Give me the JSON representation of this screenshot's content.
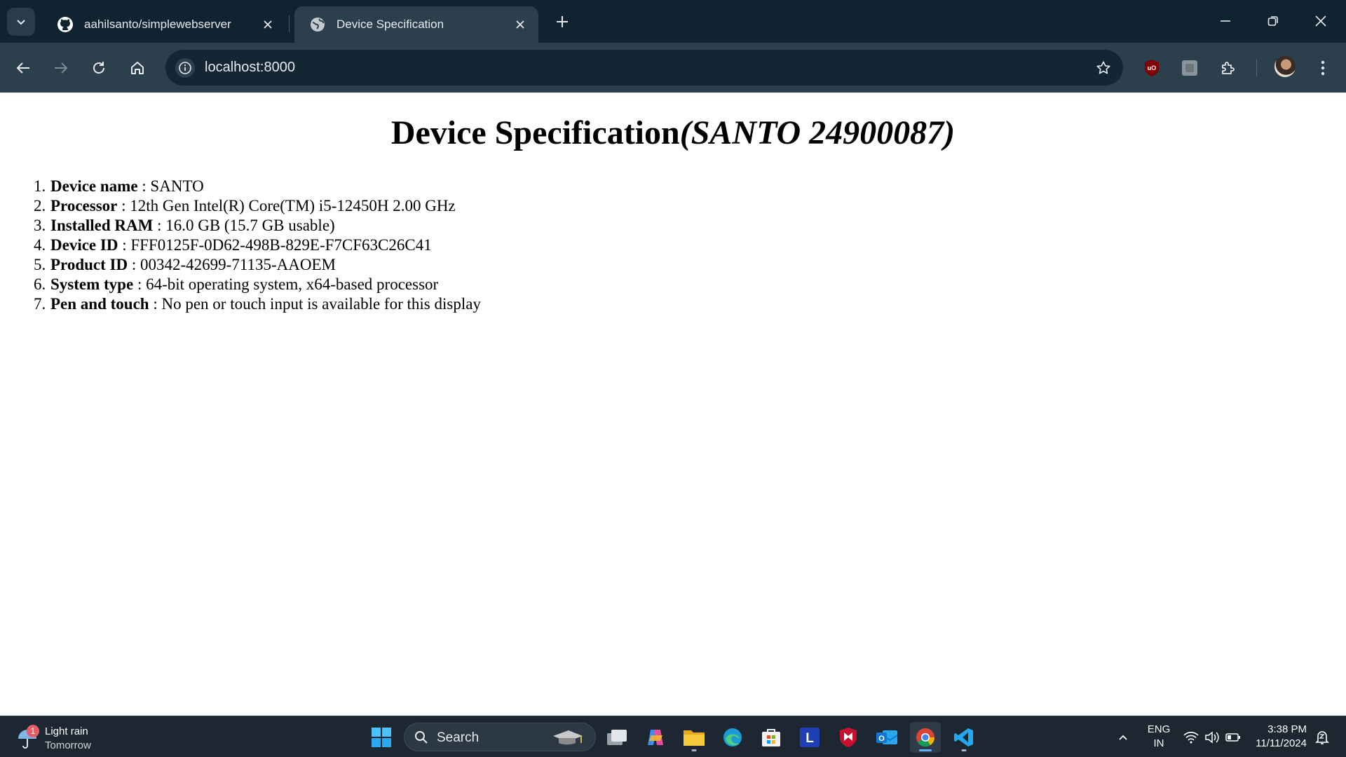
{
  "browser": {
    "tabs": [
      {
        "title": "aahilsanto/simplewebserver",
        "icon": "github-icon",
        "active": false
      },
      {
        "title": "Device Specification",
        "icon": "globe-icon",
        "active": true
      }
    ],
    "url": "localhost:8000"
  },
  "page": {
    "heading_main": "Device Specification",
    "heading_italic": "(SANTO 24900087)",
    "specs": [
      {
        "num": "1.",
        "label": "Device name",
        "value": " : SANTO"
      },
      {
        "num": "2.",
        "label": "Processor",
        "value": " : 12th Gen Intel(R) Core(TM) i5-12450H 2.00 GHz"
      },
      {
        "num": "3.",
        "label": "Installed RAM",
        "value": " : 16.0 GB (15.7 GB usable)"
      },
      {
        "num": "4.",
        "label": "Device ID",
        "value": " : FFF0125F-0D62-498B-829E-F7CF63C26C41"
      },
      {
        "num": "5.",
        "label": "Product ID",
        "value": " : 00342-42699-71135-AAOEM"
      },
      {
        "num": "6.",
        "label": "System type",
        "value": " : 64-bit operating system, x64-based processor"
      },
      {
        "num": "7.",
        "label": "Pen and touch",
        "value": " : No pen or touch input is available for this display"
      }
    ]
  },
  "taskbar": {
    "weather": {
      "badge": "1",
      "title": "Light rain",
      "subtitle": "Tomorrow"
    },
    "search_label": "Search",
    "language": {
      "line1": "ENG",
      "line2": "IN"
    },
    "clock": {
      "time": "3:38 PM",
      "date": "11/11/2024"
    }
  },
  "colors": {
    "tabbar_bg": "#0f2330",
    "toolbar_bg": "#2c3f4c",
    "taskbar_bg": "#1c2731",
    "page_bg": "#ffffff"
  }
}
